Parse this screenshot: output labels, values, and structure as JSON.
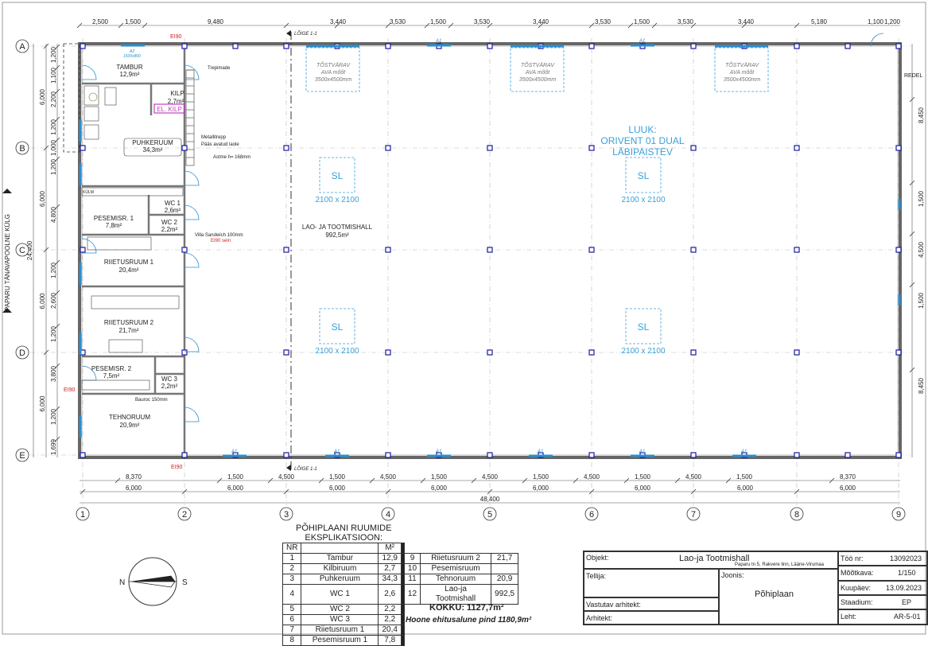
{
  "grid": {
    "columns": [
      "1",
      "2",
      "3",
      "4",
      "5",
      "6",
      "7",
      "8",
      "9"
    ],
    "rows": [
      "A",
      "B",
      "C",
      "D",
      "E"
    ]
  },
  "dims": {
    "top": [
      "2,500",
      "1,500",
      "9,480",
      "3,440",
      "3,530",
      "1,500",
      "3,530",
      "3,440",
      "3,530",
      "1,500",
      "3,530",
      "3,440",
      "5,180",
      "1,100",
      "1,200"
    ],
    "bottom_row1": [
      "8,370",
      "1,500",
      "4,500",
      "1,500",
      "4,500",
      "1,500",
      "4,500",
      "1,500",
      "4,500",
      "1,500",
      "4,500",
      "1,500",
      "8,370"
    ],
    "bottom_row2": [
      "6,000",
      "6,000",
      "6,000",
      "6,000",
      "6,000",
      "6,000",
      "6,000",
      "6,000"
    ],
    "bottom_total": "48,400",
    "left_inner": [
      "1,200",
      "1,100",
      "2,200",
      "1,200",
      "1,000",
      "1,200",
      "4,800",
      "1,200",
      "2,600",
      "1,200",
      "3,800",
      "1,200",
      "1,699"
    ],
    "left_outer": [
      "6,000",
      "6,000",
      "6,000",
      "6,000"
    ],
    "left_total": "24,400",
    "right": [
      "8,450",
      "1,500",
      "4,500",
      "1,500",
      "8,450"
    ]
  },
  "labels": {
    "street": "PAPARU TÄNAVAPOOLNE KÜLG",
    "section_top": "LÕIGE 1-1",
    "section_bottom": "LÕIGE 1-1",
    "ei90": "EI90",
    "redel": "REDEL",
    "trepimade": "Trepimade",
    "metallitrepp": "Metallitrepp",
    "paas": "Pääs avatud laole",
    "astme": "Astme h= 168mm",
    "villa": "Villa Sandwich 100mm",
    "ei90_sein": "EI90 sein",
    "bauroc": "Bauroc 150mm",
    "kulm": "KÜLM"
  },
  "rooms": [
    {
      "name": "TAMBUR",
      "area": "12,9m²"
    },
    {
      "name": "KILP",
      "area": "2,7m²"
    },
    {
      "name": "EL. KILP",
      "area": ""
    },
    {
      "name": "PUHKERUUM",
      "area": "34,3m²"
    },
    {
      "name": "WC 1",
      "area": "2,6m²"
    },
    {
      "name": "PESEMISR. 1",
      "area": "7,8m²"
    },
    {
      "name": "WC 2",
      "area": "2,2m²"
    },
    {
      "name": "RIIETUSRUUM 1",
      "area": "20,4m²"
    },
    {
      "name": "RIIETUSRUUM 2",
      "area": "21,7m²"
    },
    {
      "name": "PESEMISR. 2",
      "area": "7,5m²"
    },
    {
      "name": "WC 3",
      "area": "2,2m²"
    },
    {
      "name": "TEHNORUUM",
      "area": "20,9m²"
    },
    {
      "name": "LAO- JA TOOTMISHALL",
      "area": "992,5m²"
    }
  ],
  "gates": [
    {
      "title": "TÕSTVÄRAV",
      "sub": "AVA mõõt",
      "size": "3500x4500mm"
    },
    {
      "title": "TÕSTVÄRAV",
      "sub": "AVA mõõt",
      "size": "3500x4500mm"
    },
    {
      "title": "TÕSTVÄRAV",
      "sub": "AVA mõõt",
      "size": "3500x4500mm"
    }
  ],
  "hatch": {
    "line1": "LUUK:",
    "line2": "ORIVENT 01 DUAL",
    "line3": "LÄBIPAISTEV"
  },
  "skylights": [
    {
      "label": "SL",
      "size": "2100 x 2100"
    },
    {
      "label": "SL",
      "size": "2100 x 2100"
    },
    {
      "label": "SL",
      "size": "2100 x 2100"
    },
    {
      "label": "SL",
      "size": "2100 x 2100"
    }
  ],
  "window_tags": {
    "a1": "A1",
    "a2_top": "A2",
    "a2_top_size": "1500x800"
  },
  "compass": {
    "n": "N",
    "s": "S"
  },
  "explication": {
    "title1": "PÕHIPLAANI RUUMIDE",
    "title2": "EKSPLIKATSIOON:",
    "head": {
      "nr": "NR",
      "unit": "M²"
    },
    "rows_left": [
      {
        "nr": "1",
        "name": "Tambur",
        "area": "12,9"
      },
      {
        "nr": "2",
        "name": "Kilbiruum",
        "area": "2,7"
      },
      {
        "nr": "3",
        "name": "Puhkeruum",
        "area": "34,3"
      },
      {
        "nr": "4",
        "name": "WC 1",
        "area": "2,6"
      },
      {
        "nr": "5",
        "name": "WC 2",
        "area": "2,2"
      },
      {
        "nr": "6",
        "name": "WC 3",
        "area": "2,2"
      },
      {
        "nr": "7",
        "name": "Riietusruum 1",
        "area": "20,4"
      },
      {
        "nr": "8",
        "name": "Pesemisruum 1",
        "area": "7,8"
      }
    ],
    "rows_right": [
      {
        "nr": "9",
        "name": "Riietusruum 2",
        "area": "21,7"
      },
      {
        "nr": "10",
        "name": "Pesemisruum",
        "area": ""
      },
      {
        "nr": "11",
        "name": "Tehnoruum",
        "area": "20,9"
      },
      {
        "nr": "12",
        "name": "Lao-ja Tootmishall",
        "area": "992,5"
      }
    ],
    "total": "KOKKU: 1127,7m²",
    "footprint": "Hoone ehitusalune pind 1180,9m²"
  },
  "title_block": {
    "objekt_label": "Objekt:",
    "objekt": "Lao-ja Tootmishall",
    "address": "Paparu tn 5, Rakvere linn, Lääne-Virumaa",
    "tellija_label": "Tellija:",
    "joonis_label": "Joonis:",
    "joonis": "Põhiplaan",
    "vastutav_label": "Vastutav arhitekt:",
    "arhitekt_label": "Arhitekt:",
    "too_nr_label": "Töö nr:",
    "too_nr": "13092023",
    "mootkava_label": "Mõõtkava:",
    "mootkava": "1/150",
    "kuupaev_label": "Kuupäev:",
    "kuupaev": "13.09.2023",
    "staadium_label": "Staadium:",
    "staadium": "EP",
    "leht_label": "Leht:",
    "leht": "AR-5-01"
  }
}
